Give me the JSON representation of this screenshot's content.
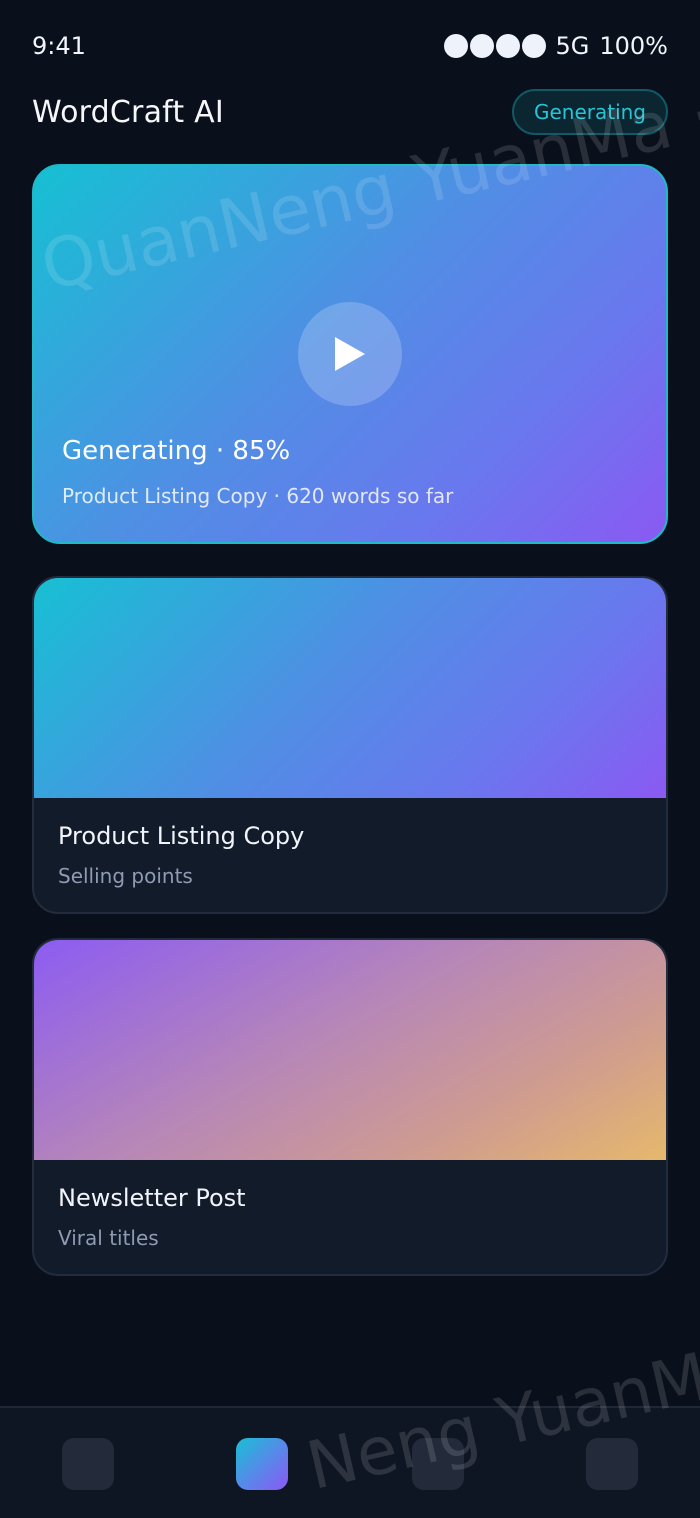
{
  "status_bar": {
    "time": "9:41",
    "network": "5G",
    "battery": "100%"
  },
  "header": {
    "title": "WordCraft AI",
    "badge": "Generating"
  },
  "hero": {
    "status": "Generating · 85%",
    "subtitle": "Product Listing Copy · 620 words so far",
    "progress_percent": 85,
    "play_icon": "play-icon"
  },
  "cards": [
    {
      "title": "Product Listing Copy",
      "subtitle": "Selling points"
    },
    {
      "title": "Newsletter Post",
      "subtitle": "Viral titles"
    }
  ],
  "colors": {
    "background": "#0a101b",
    "accent_cyan": "#17c0d3",
    "accent_violet": "#8b59f3",
    "warm_accent": "#e6b86c",
    "card_surface": "#121b2a"
  },
  "watermark": {
    "text_top": "QuanNeng YuanMa · in",
    "text_bottom": "Neng YuanMa"
  }
}
